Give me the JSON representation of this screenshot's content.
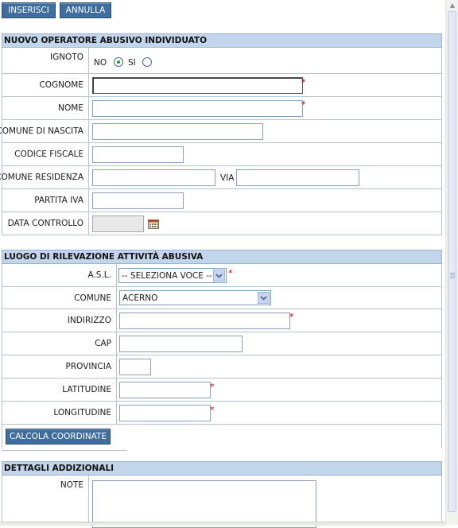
{
  "toolbar": {
    "insert_label": "INSERISCI",
    "cancel_label": "ANNULLA"
  },
  "section_operator": {
    "title": "NUOVO OPERATORE ABUSIVO INDIVIDUATO",
    "unknown": {
      "label": "IGNOTO",
      "option_no": "NO",
      "option_si": "SI",
      "selected": "NO"
    },
    "surname": {
      "label": "COGNOME",
      "value": "",
      "required": true
    },
    "name": {
      "label": "NOME",
      "value": "",
      "required": true
    },
    "birth_town": {
      "label": "COMUNE DI NASCITA",
      "value": ""
    },
    "tax_code": {
      "label": "CODICE FISCALE",
      "value": ""
    },
    "residence": {
      "label": "COMUNE RESIDENZA",
      "value": "",
      "street_label": "VIA",
      "street_value": ""
    },
    "vat": {
      "label": "PARTITA IVA",
      "value": ""
    },
    "check_date": {
      "label": "DATA CONTROLLO",
      "value": ""
    }
  },
  "section_location": {
    "title": "LUOGO DI RILEVAZIONE ATTIVITÀ ABUSIVA",
    "asl": {
      "label": "A.S.L.",
      "selected": "-- SELEZIONA VOCE --",
      "required": true
    },
    "town": {
      "label": "COMUNE",
      "selected": "ACERNO"
    },
    "address": {
      "label": "INDIRIZZO",
      "value": "",
      "required": true
    },
    "zip": {
      "label": "CAP",
      "value": ""
    },
    "province": {
      "label": "PROVINCIA",
      "value": ""
    },
    "latitude": {
      "label": "LATITUDINE",
      "value": "",
      "required": true
    },
    "longitude": {
      "label": "LONGITUDINE",
      "value": "",
      "required": true
    },
    "compute_label": "CALCOLA COORDINATE"
  },
  "section_details": {
    "title": "DETTAGLI ADDIZIONALI",
    "notes": {
      "label": "NOTE",
      "value": ""
    }
  },
  "required_mark": "*",
  "colors": {
    "button": "#3f6d9e",
    "header": "#c3d5ea",
    "required": "#d00000"
  },
  "icons": {
    "calendar": "calendar-icon",
    "dropdown": "chevron-down-icon"
  }
}
